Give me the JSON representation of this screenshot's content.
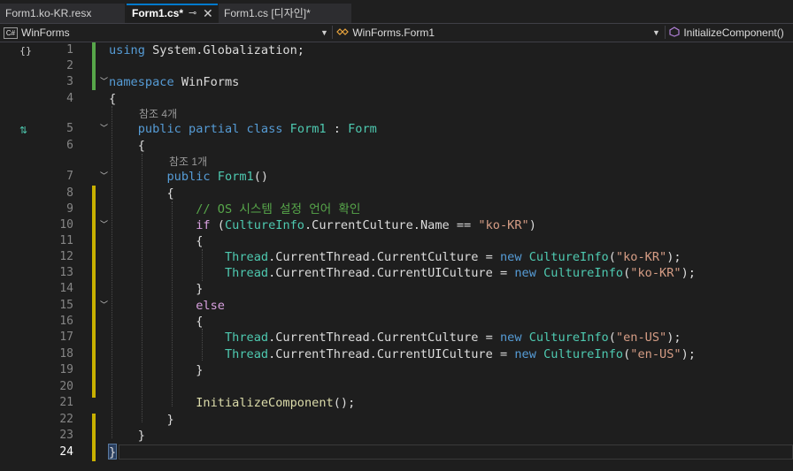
{
  "tabs": [
    {
      "label": "Form1.ko-KR.resx"
    },
    {
      "label": "Form1.cs*",
      "pin": "⊸",
      "close": "✕"
    },
    {
      "label": "Form1.cs [디자인]*"
    }
  ],
  "nav": {
    "project": "WinForms",
    "class": "WinForms.Form1",
    "member": "InitializeComponent()",
    "cs_badge": "C#"
  },
  "gutter": {
    "line1_icon": "{}",
    "line5_icon": "⇅"
  },
  "code": {
    "l1": {
      "num": "1",
      "t1": "using",
      "t2": " System.Globalization;"
    },
    "l2": {
      "num": "2"
    },
    "l3": {
      "num": "3",
      "t1": "namespace",
      "t2": " WinForms"
    },
    "l4": {
      "num": "4",
      "t1": "{"
    },
    "lens1": "참조 4개",
    "l5": {
      "num": "5",
      "t1": "public",
      "t2": " ",
      "t3": "partial",
      "t4": " ",
      "t5": "class",
      "t6": " ",
      "t7": "Form1",
      "t8": " : ",
      "t9": "Form"
    },
    "l6": {
      "num": "6",
      "t1": "{"
    },
    "lens2": "참조 1개",
    "l7": {
      "num": "7",
      "t1": "public",
      "t2": " ",
      "t3": "Form1",
      "t4": "()"
    },
    "l8": {
      "num": "8",
      "t1": "{"
    },
    "l9": {
      "num": "9",
      "t1": "// OS 시스템 설정 언어 확인"
    },
    "l10": {
      "num": "10",
      "t1": "if",
      "t2": " (",
      "t3": "CultureInfo",
      "t4": ".CurrentCulture.Name == ",
      "t5": "\"ko-KR\"",
      "t6": ")"
    },
    "l11": {
      "num": "11",
      "t1": "{"
    },
    "l12": {
      "num": "12",
      "t1": "Thread",
      "t2": ".CurrentThread.CurrentCulture = ",
      "t3": "new",
      "t4": " ",
      "t5": "CultureInfo",
      "t6": "(",
      "t7": "\"ko-KR\"",
      "t8": ");"
    },
    "l13": {
      "num": "13",
      "t1": "Thread",
      "t2": ".CurrentThread.CurrentUICulture = ",
      "t3": "new",
      "t4": " ",
      "t5": "CultureInfo",
      "t6": "(",
      "t7": "\"ko-KR\"",
      "t8": ");"
    },
    "l14": {
      "num": "14",
      "t1": "}"
    },
    "l15": {
      "num": "15",
      "t1": "else"
    },
    "l16": {
      "num": "16",
      "t1": "{"
    },
    "l17": {
      "num": "17",
      "t1": "Thread",
      "t2": ".CurrentThread.CurrentCulture = ",
      "t3": "new",
      "t4": " ",
      "t5": "CultureInfo",
      "t6": "(",
      "t7": "\"en-US\"",
      "t8": ");"
    },
    "l18": {
      "num": "18",
      "t1": "Thread",
      "t2": ".CurrentThread.CurrentUICulture = ",
      "t3": "new",
      "t4": " ",
      "t5": "CultureInfo",
      "t6": "(",
      "t7": "\"en-US\"",
      "t8": ");"
    },
    "l19": {
      "num": "19",
      "t1": "}"
    },
    "l20": {
      "num": "20"
    },
    "l21": {
      "num": "21",
      "t1": "InitializeComponent",
      "t2": "();"
    },
    "l22": {
      "num": "22",
      "t1": "}"
    },
    "l23": {
      "num": "23",
      "t1": "}"
    },
    "l24": {
      "num": "24",
      "t1": "}"
    }
  },
  "colors": {
    "keyword": "#569cd6",
    "type": "#4ec9b0",
    "method": "#dcdcaa",
    "string": "#d69d85",
    "comment": "#57a64a",
    "control": "#d8a0df",
    "changed_saved": "#57a64a",
    "changed_unsaved": "#c8b000"
  },
  "icons": {
    "pin": "pin-icon",
    "close": "close-icon",
    "dropdown": "chevron-down-icon",
    "class": "class-icon",
    "method": "method-icon"
  }
}
